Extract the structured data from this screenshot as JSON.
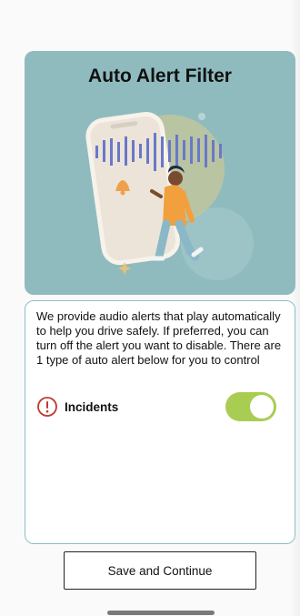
{
  "header": {
    "title": "Auto Alert Filter"
  },
  "info": {
    "description": "We provide audio alerts that play automatically to help you drive safely. If preferred, you can turn off the alert you want to disable. There are 1 type of auto alert below for you to control",
    "alerts": [
      {
        "label": "Incidents",
        "icon": "warning-circle-icon",
        "enabled": true
      }
    ]
  },
  "footer": {
    "save_label": "Save and Continue"
  },
  "colors": {
    "hero_bg": "#8fbbbf",
    "card_border": "#8cc0c4",
    "toggle_on": "#a9cd53",
    "warning": "#c0392b"
  }
}
